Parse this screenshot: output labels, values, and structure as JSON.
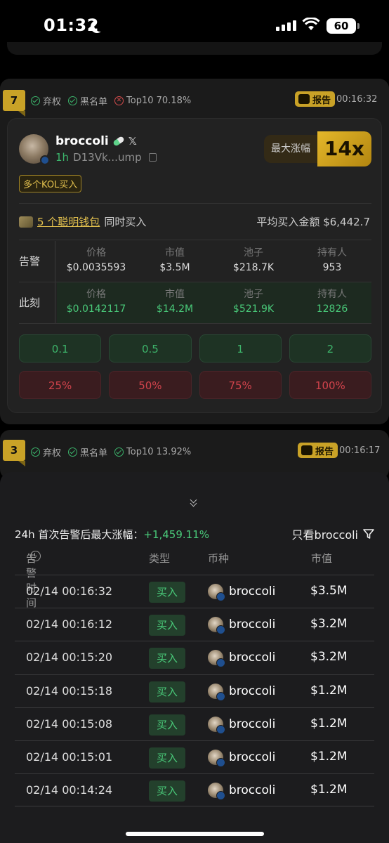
{
  "status_bar": {
    "time": "01:32",
    "battery": "60"
  },
  "alert1": {
    "rank": "7",
    "checks": [
      {
        "label": "弃权",
        "ok": true
      },
      {
        "label": "黑名单",
        "ok": true
      },
      {
        "label": "Top10 70.18%",
        "ok": false
      }
    ],
    "report_label": "报告",
    "time": "00:16:32",
    "token": {
      "name": "broccoli",
      "age": "1h",
      "address": "D13Vk...ump"
    },
    "kol_tag": "多个KOL买入",
    "max_rise_label": "最大涨幅",
    "max_rise_value": "14x",
    "smart_link": "5 个聪明钱包",
    "smart_suffix": "同时买入",
    "avg_buy": "平均买入金额 $6,442.7",
    "table_headers": [
      "价格",
      "市值",
      "池子",
      "持有人"
    ],
    "alert_row": {
      "label": "告警",
      "values": [
        "$0.0035593",
        "$3.5M",
        "$218.7K",
        "953"
      ]
    },
    "now_row": {
      "label": "此刻",
      "values": [
        "$0.0142117",
        "$14.2M",
        "$521.9K",
        "12826"
      ]
    },
    "buy_buttons": [
      "0.1",
      "0.5",
      "1",
      "2"
    ],
    "sell_buttons": [
      "25%",
      "50%",
      "75%",
      "100%"
    ]
  },
  "alert2": {
    "rank": "3",
    "checks": [
      {
        "label": "弃权",
        "ok": true
      },
      {
        "label": "黑名单",
        "ok": true
      },
      {
        "label": "Top10 13.92%",
        "ok": true
      }
    ],
    "report_label": "报告",
    "time": "00:16:17"
  },
  "sheet": {
    "title_prefix": "24h 首次告警后最大涨幅：",
    "title_pct": "+1,459.11%",
    "only_label": "只看broccoli",
    "headers": {
      "time": "告警时间",
      "type": "类型",
      "coin": "币种",
      "mc": "市值"
    },
    "rows": [
      {
        "time": "02/14 00:16:32",
        "type": "买入",
        "coin": "broccoli",
        "mc": "$3.5M"
      },
      {
        "time": "02/14 00:16:12",
        "type": "买入",
        "coin": "broccoli",
        "mc": "$3.2M"
      },
      {
        "time": "02/14 00:15:20",
        "type": "买入",
        "coin": "broccoli",
        "mc": "$3.2M"
      },
      {
        "time": "02/14 00:15:18",
        "type": "买入",
        "coin": "broccoli",
        "mc": "$1.2M"
      },
      {
        "time": "02/14 00:15:08",
        "type": "买入",
        "coin": "broccoli",
        "mc": "$1.2M"
      },
      {
        "time": "02/14 00:15:01",
        "type": "买入",
        "coin": "broccoli",
        "mc": "$1.2M"
      },
      {
        "time": "02/14 00:14:24",
        "type": "买入",
        "coin": "broccoli",
        "mc": "$1.2M"
      }
    ]
  },
  "colors": {
    "accent_gold": "#c9a227",
    "buy_green": "#49c979",
    "sell_red": "#d1434c"
  }
}
